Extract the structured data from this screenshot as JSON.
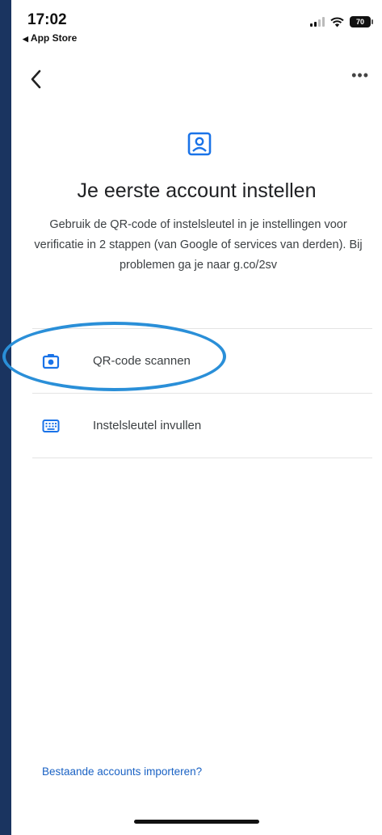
{
  "status_bar": {
    "time": "17:02",
    "back_app_label": "App Store",
    "battery": "70"
  },
  "nav": {
    "back_icon": "chevron-left-icon",
    "more_label": "•••"
  },
  "main": {
    "hero_icon": "account-box-icon",
    "title": "Je eerste account instellen",
    "description": "Gebruik de QR-code of instelsleutel in je instellingen voor verificatie in 2 stappen (van Google of services van derden). Bij problemen ga je naar g.co/2sv",
    "options": [
      {
        "label": "QR-code scannen",
        "icon": "camera-icon"
      },
      {
        "label": "Instelsleutel invullen",
        "icon": "keyboard-icon"
      }
    ]
  },
  "footer": {
    "import_link": "Bestaande accounts importeren?"
  },
  "colors": {
    "accent": "#1a73e8",
    "highlight": "#2a8fd8",
    "frame": "#1a3460"
  }
}
